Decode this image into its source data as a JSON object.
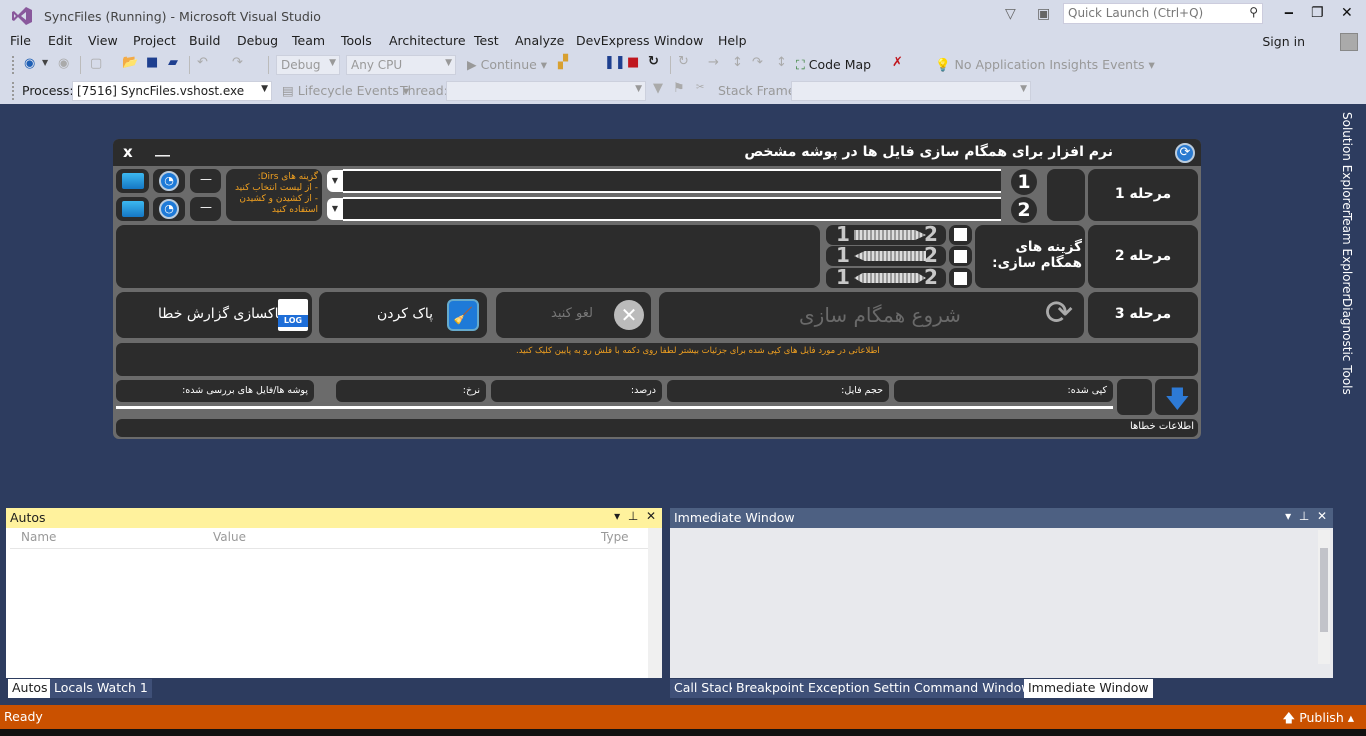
{
  "window": {
    "title": "SyncFiles (Running) - Microsoft Visual Studio",
    "quick_launch_placeholder": "Quick Launch (Ctrl+Q)",
    "sign_in": "Sign in"
  },
  "menu": [
    "File",
    "Edit",
    "View",
    "Project",
    "Build",
    "Debug",
    "Team",
    "Tools",
    "Architecture",
    "Test",
    "Analyze",
    "DevExpress",
    "Window",
    "Help"
  ],
  "toolbar": {
    "config": "Debug",
    "platform": "Any CPU",
    "continue": "Continue",
    "code_map": "Code Map",
    "insights": "No Application Insights Events"
  },
  "toolbar2": {
    "process_label": "Process:",
    "process_value": "[7516] SyncFiles.vshost.exe",
    "lifecycle": "Lifecycle Events",
    "thread_label": "Thread:",
    "stack_frame_label": "Stack Frame:"
  },
  "side_tabs": [
    "Solution Explorer",
    "Team Explorer",
    "Diagnostic Tools"
  ],
  "app": {
    "title": "نرم افزار برای همگام سازی فایل ها در پوشه مشخص",
    "close": "x",
    "minimize": "__",
    "step1": "مرحله 1",
    "step2": "مرحله 2",
    "step3": "مرحله 3",
    "num1": "1",
    "num2": "2",
    "dirs_note": "گزینه های Dirs:\n- از لیست انتخاب کنید\n- از کشیدن و کشیدن استفاده کنید",
    "dash": "—",
    "path1": "",
    "path2": "",
    "sync_options_label": "گزینه های همگام سازی:",
    "sync_options": [
      {
        "from": "1",
        "to": "2",
        "direction": "one-way-right",
        "checked": false
      },
      {
        "from": "1",
        "to": "2",
        "direction": "one-way-left",
        "checked": false
      },
      {
        "from": "1",
        "to": "2",
        "direction": "two-way",
        "checked": false
      }
    ],
    "start_sync": "شروع همگام سازی",
    "cancel": "لغو کنید",
    "clear": "پاک کردن",
    "clear_log": "پاکسازی گزارش خطا",
    "log_icon_text": "LOG",
    "info_note": "اطلاعاتی در مورد فایل های کپی شده برای جزئیات بیشتر لطفا روی دکمه با فلش رو به پایین کلیک کنید.",
    "stats": {
      "copied": "کپی شده:",
      "file_size": "حجم فایل:",
      "percent": "درصد:",
      "rate": "نرخ:",
      "scanned": "پوشه ها/فایل های بررسی شده:"
    },
    "progress": 0,
    "error_info": "اطلاعات خطاها"
  },
  "autos": {
    "title": "Autos",
    "columns": [
      "Name",
      "Value",
      "Type"
    ],
    "tabs": [
      "Autos",
      "Locals",
      "Watch 1"
    ]
  },
  "immediate": {
    "title": "Immediate Window",
    "tabs": [
      "Call Stack",
      "Breakpoints",
      "Exception Settings",
      "Command Window",
      "Immediate Window"
    ]
  },
  "status": {
    "text": "Ready",
    "publish": "Publish"
  }
}
